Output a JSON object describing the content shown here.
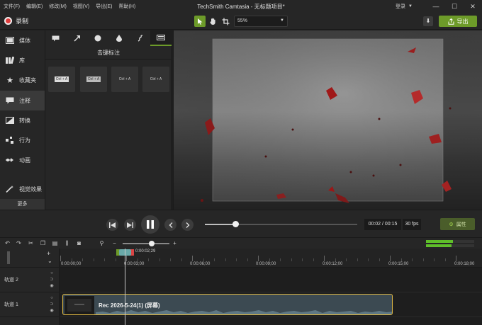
{
  "window": {
    "title": "TechSmith Camtasia - 无标题项目*",
    "menus": [
      "文件(F)",
      "编辑(E)",
      "修改(M)",
      "视图(V)",
      "导出(E)",
      "帮助(H)"
    ],
    "login": "登录",
    "controls": [
      "—",
      "☐",
      "✕"
    ]
  },
  "toolbar": {
    "record_label": "录制",
    "zoom_value": "55%",
    "export_label": "导出"
  },
  "sidebar": {
    "items": [
      {
        "label": "媒体",
        "icon": "media-icon"
      },
      {
        "label": "库",
        "icon": "library-icon"
      },
      {
        "label": "收藏夹",
        "icon": "star-icon"
      },
      {
        "label": "注释",
        "icon": "annotation-icon",
        "active": true
      },
      {
        "label": "转换",
        "icon": "transition-icon"
      },
      {
        "label": "行为",
        "icon": "behavior-icon"
      },
      {
        "label": "动画",
        "icon": "animation-icon"
      },
      {
        "label": "视觉效果",
        "icon": "visual-effects-icon"
      }
    ],
    "more_label": "更多"
  },
  "panel": {
    "title": "击键标注",
    "tiles": [
      {
        "keys": "Ctrl + A"
      },
      {
        "keys": "Ctrl + A"
      },
      {
        "keys": "Ctrl + A"
      },
      {
        "keys": "Ctrl + A"
      }
    ]
  },
  "playback": {
    "time": "00:02 / 00:15",
    "fps": "30 fps",
    "properties_label": "属性",
    "progress": 0.2
  },
  "timeline": {
    "playhead_time": "0:00:02;29",
    "ruler_labels": [
      "0:00:00;00",
      "0:00:03;00",
      "0:00:06;00",
      "0:00:09;00",
      "0:00:12;00",
      "0:00:15;00",
      "0:00:18;00"
    ],
    "tracks": [
      {
        "label": "轨道 2"
      },
      {
        "label": "轨道 1"
      }
    ],
    "clip_label": "Rec 2026-5-24(1) (屏幕)"
  },
  "colors": {
    "accent": "#6d9b29",
    "record": "#e03c3c",
    "clip_border": "#e0b842"
  }
}
